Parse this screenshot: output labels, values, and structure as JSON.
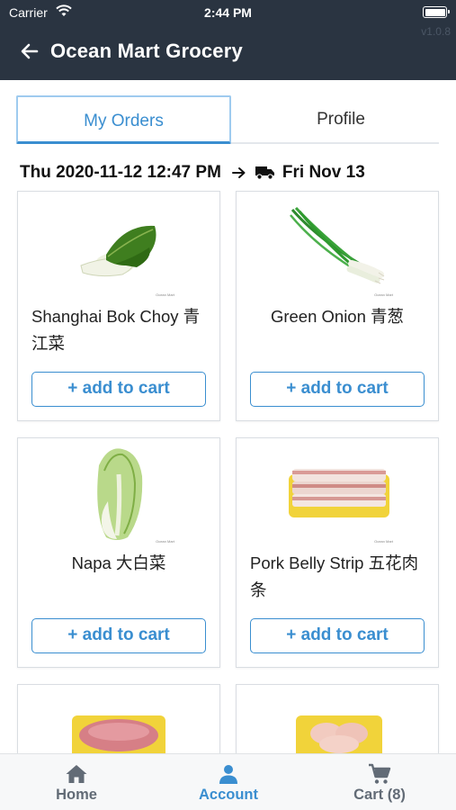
{
  "status_bar": {
    "carrier": "Carrier",
    "time": "2:44 PM"
  },
  "header": {
    "title": "Ocean Mart Grocery",
    "version": "v1.0.8"
  },
  "tabs": [
    {
      "label": "My Orders",
      "active": true
    },
    {
      "label": "Profile",
      "active": false
    }
  ],
  "order": {
    "placed": "Thu 2020-11-12 12:47 PM",
    "delivery": "Fri Nov 13"
  },
  "products": [
    {
      "name": "Shanghai Bok Choy 青江菜",
      "button": "+ add to cart",
      "brand": "Ocean Mart"
    },
    {
      "name": "Green Onion 青葱",
      "button": "+ add to cart",
      "brand": "Ocean Mart"
    },
    {
      "name": "Napa 大白菜",
      "button": "+ add to cart",
      "brand": "Ocean Mart"
    },
    {
      "name": "Pork Belly Strip 五花肉条",
      "button": "+ add to cart",
      "brand": "Ocean Mart"
    }
  ],
  "bottom_nav": [
    {
      "label": "Home",
      "icon": "home-icon",
      "active": false
    },
    {
      "label": "Account",
      "icon": "user-icon",
      "active": true
    },
    {
      "label": "Cart (8)",
      "icon": "cart-icon",
      "active": false
    }
  ],
  "colors": {
    "header_bg": "#2a3441",
    "accent": "#3a8ed0",
    "nav_inactive": "#626b76"
  }
}
